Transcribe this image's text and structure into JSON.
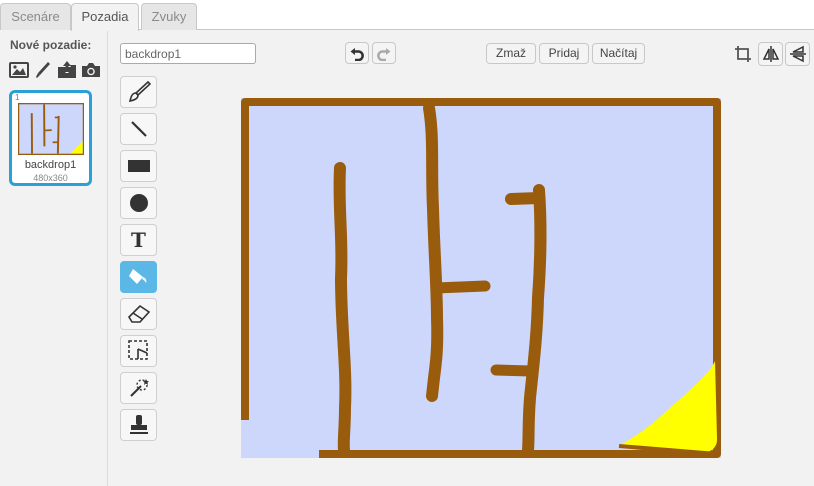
{
  "tabs": [
    {
      "label": "Scenáre",
      "active": false
    },
    {
      "label": "Pozadia",
      "active": true
    },
    {
      "label": "Zvuky",
      "active": false
    }
  ],
  "sidebar": {
    "new_backdrop_label": "Nové pozadie:",
    "new_backdrop_icons": [
      "image-library-icon",
      "paint-brush-icon",
      "upload-icon",
      "camera-icon"
    ],
    "backdrops": [
      {
        "number": "1",
        "name": "backdrop1",
        "size": "480x360",
        "selected": true
      }
    ]
  },
  "editor": {
    "backdrop_name_value": "backdrop1",
    "undo_icon": "undo-icon",
    "redo_icon": "redo-icon",
    "clear_label": "Zmaž",
    "add_label": "Pridaj",
    "import_label": "Načítaj",
    "transform_icons": [
      "crop-icon",
      "flip-horizontal-icon",
      "flip-vertical-icon"
    ],
    "tools": [
      {
        "name": "brush-tool",
        "icon": "paintbrush-icon",
        "active": false
      },
      {
        "name": "line-tool",
        "icon": "line-icon",
        "active": false
      },
      {
        "name": "rectangle-tool",
        "icon": "rectangle-icon",
        "active": false
      },
      {
        "name": "ellipse-tool",
        "icon": "ellipse-icon",
        "active": false
      },
      {
        "name": "text-tool",
        "icon": "text-icon",
        "glyph": "T",
        "active": false
      },
      {
        "name": "fill-tool",
        "icon": "paint-bucket-icon",
        "active": true
      },
      {
        "name": "eraser-tool",
        "icon": "eraser-icon",
        "active": false
      },
      {
        "name": "select-tool",
        "icon": "select-icon",
        "active": false
      },
      {
        "name": "magic-wand-tool",
        "icon": "magic-wand-icon",
        "active": false
      },
      {
        "name": "stamp-tool",
        "icon": "stamp-icon",
        "active": false
      }
    ]
  },
  "colors": {
    "canvas_fill": "#ccd7fb",
    "wall_brown": "#995c0d",
    "yellow": "#ffff00",
    "accent_blue": "#2a9fd8",
    "active_tool": "#5bb7e5"
  }
}
